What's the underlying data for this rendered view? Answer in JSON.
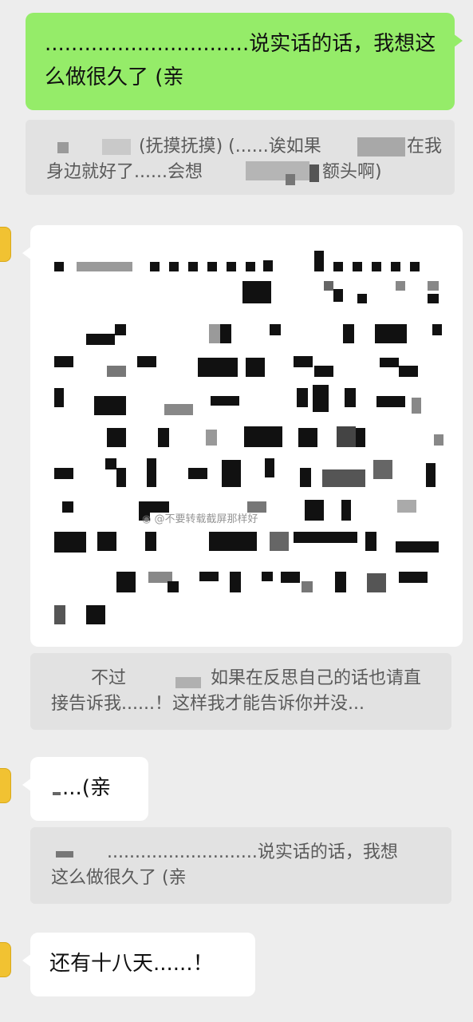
{
  "messages": {
    "m1": {
      "text": "...............................说实话的话，我想这么做很久了 (亲"
    },
    "q1": {
      "line1": "(抚摸抚摸) (......诶如果",
      "line1b": "在我",
      "line2": "身边就好了......会想",
      "line2b": "额头啊)"
    },
    "q2": {
      "line1a": "不过",
      "line1b": "如果在反思自己的话也请直",
      "line2": "接告诉我......！这样我才能告诉你并没..."
    },
    "m4": {
      "text": "...(亲"
    },
    "q3": {
      "line1": "...........................说实话的话，我想",
      "line2": "这么做很久了 (亲"
    },
    "m5": {
      "text": "还有十八天......！"
    }
  },
  "watermark": {
    "text": "@不要转载截屏那样好",
    "icon": "weibo-icon"
  },
  "colors": {
    "sent_bubble": "#95ec69",
    "received_bubble": "#ffffff",
    "quote_bg": "#e2e2e2",
    "background": "#ededed"
  }
}
